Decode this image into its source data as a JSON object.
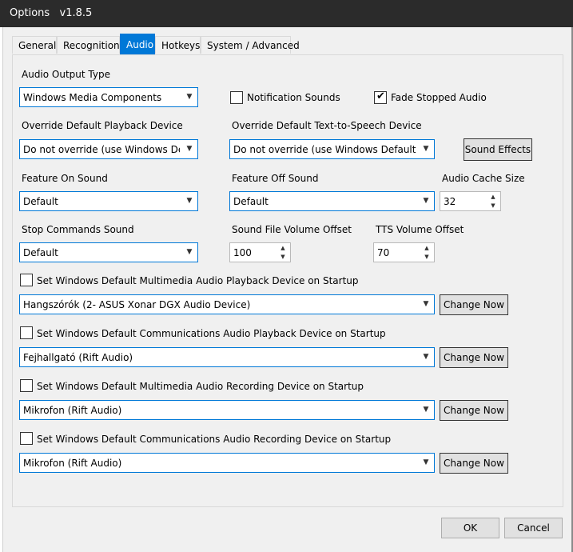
{
  "window": {
    "title": "Options   v1.8.5"
  },
  "tabs": [
    "General",
    "Recognition",
    "Audio",
    "Hotkeys",
    "System / Advanced"
  ],
  "audio": {
    "output_type_label": "Audio Output Type",
    "output_type_value": "Windows Media Components",
    "notification_sounds_label": "Notification Sounds",
    "notification_sounds_checked": false,
    "fade_stopped_label": "Fade Stopped Audio",
    "fade_stopped_checked": true,
    "override_playback_label": "Override Default Playback Device",
    "override_playback_value": "Do not override (use Windows Defa",
    "override_tts_label": "Override Default Text-to-Speech Device",
    "override_tts_value": "Do not override (use Windows Default Pla",
    "sound_effects_button": "Sound Effects",
    "feature_on_label": "Feature On Sound",
    "feature_on_value": "Default",
    "feature_off_label": "Feature Off Sound",
    "feature_off_value": "Default",
    "cache_size_label": "Audio Cache Size",
    "cache_size_value": "32",
    "stop_commands_label": "Stop Commands Sound",
    "stop_commands_value": "Default",
    "sound_file_offset_label": "Sound File Volume Offset",
    "sound_file_offset_value": "100",
    "tts_offset_label": "TTS Volume Offset",
    "tts_offset_value": "70",
    "devices": [
      {
        "label": "Set Windows Default Multimedia Audio Playback Device on Startup",
        "value": "Hangszórók (2- ASUS Xonar DGX Audio Device)",
        "button": "Change Now",
        "checked": false
      },
      {
        "label": "Set Windows Default Communications Audio Playback Device on Startup",
        "value": "Fejhallgató (Rift Audio)",
        "button": "Change Now",
        "checked": false
      },
      {
        "label": "Set Windows Default Multimedia Audio Recording Device on Startup",
        "value": "Mikrofon (Rift Audio)",
        "button": "Change Now",
        "checked": false
      },
      {
        "label": "Set Windows Default Communications Audio Recording Device on Startup",
        "value": "Mikrofon (Rift Audio)",
        "button": "Change Now",
        "checked": false
      }
    ]
  },
  "footer": {
    "ok": "OK",
    "cancel": "Cancel"
  },
  "icons": {
    "dropdown": "chevron-down-icon",
    "spin_up": "spin-up-icon",
    "spin_down": "spin-down-icon",
    "check": "check-icon"
  },
  "colors": {
    "accent": "#0078d7",
    "titlebar": "#2b2b2b"
  }
}
